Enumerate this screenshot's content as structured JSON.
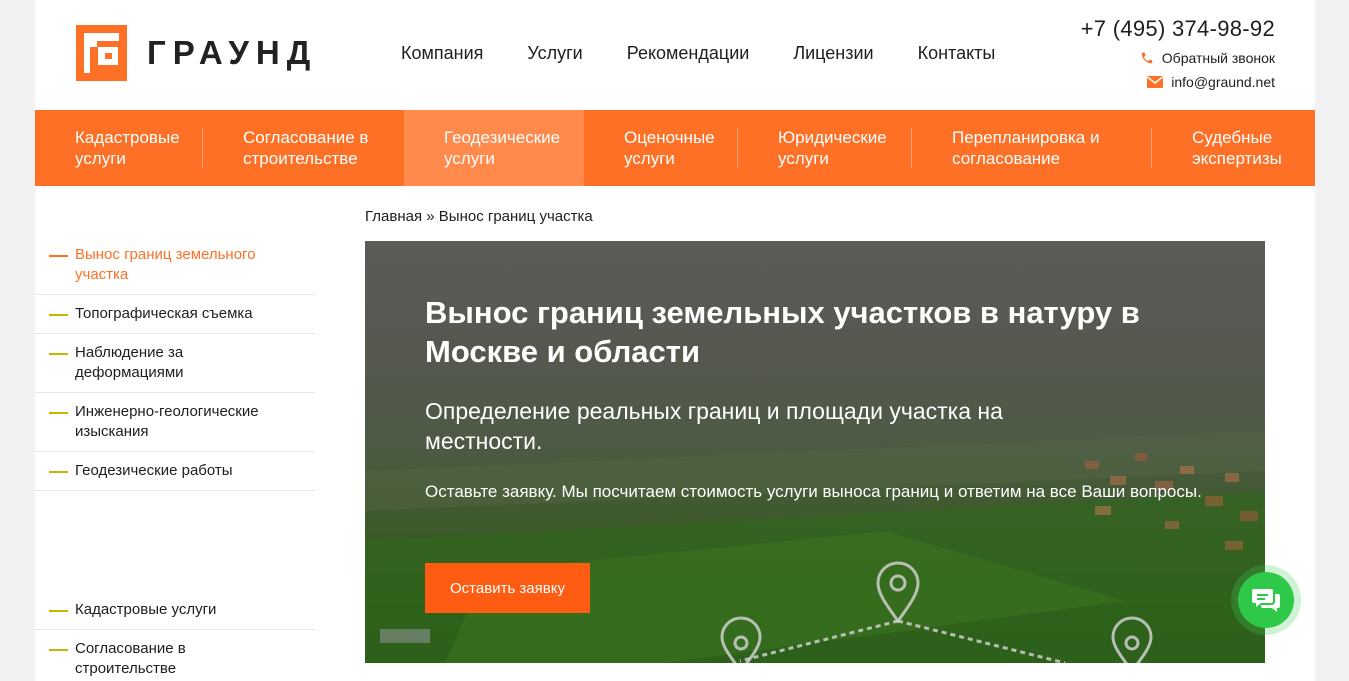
{
  "header": {
    "logo_text": "ГРАУНД",
    "nav": [
      "Компания",
      "Услуги",
      "Рекомендации",
      "Лицензии",
      "Контакты"
    ],
    "phone": "+7 (495) 374-98-92",
    "callback": "Обратный звонок",
    "email": "info@graund.net"
  },
  "catnav": [
    {
      "line1": "Кадастровые",
      "line2": "услуги"
    },
    {
      "line1": "Согласование в",
      "line2": "строительстве"
    },
    {
      "line1": "Геодезические",
      "line2": "услуги"
    },
    {
      "line1": "Оценочные",
      "line2": "услуги"
    },
    {
      "line1": "Юридические",
      "line2": "услуги"
    },
    {
      "line1": "Перепланировка и",
      "line2": "согласование"
    },
    {
      "line1": "Судебные",
      "line2": "экспертизы"
    }
  ],
  "sidebar": {
    "items": [
      {
        "label": "Вынос границ земельного участка"
      },
      {
        "label": "Топографическая съемка"
      },
      {
        "label": "Наблюдение за деформациями"
      },
      {
        "label": "Инженерно-геологические изыскания"
      },
      {
        "label": "Геодезические работы"
      }
    ],
    "items2": [
      {
        "label": "Кадастровые услуги"
      },
      {
        "label": "Согласование в строительстве"
      }
    ]
  },
  "breadcrumb": {
    "home": "Главная",
    "sep": "»",
    "current": "Вынос границ участка"
  },
  "hero": {
    "title": "Вынос границ земельных участков в натуру в Москве и области",
    "subtitle": "Определение реальных границ и площади участка на местности.",
    "text": "Оставьте заявку. Мы посчитаем стоимость услуги выноса границ и ответим на все Ваши вопросы.",
    "button": "Оставить заявку"
  },
  "colors": {
    "accent": "#fe7025",
    "accent_active": "#ff8a4c",
    "button": "#fe5c12",
    "bullet": "#c8b900",
    "chat": "#2fc949"
  },
  "icons": {
    "phone": "phone-icon",
    "email": "envelope-icon",
    "chat": "chat-bubbles-icon",
    "pin": "map-pin-icon"
  }
}
